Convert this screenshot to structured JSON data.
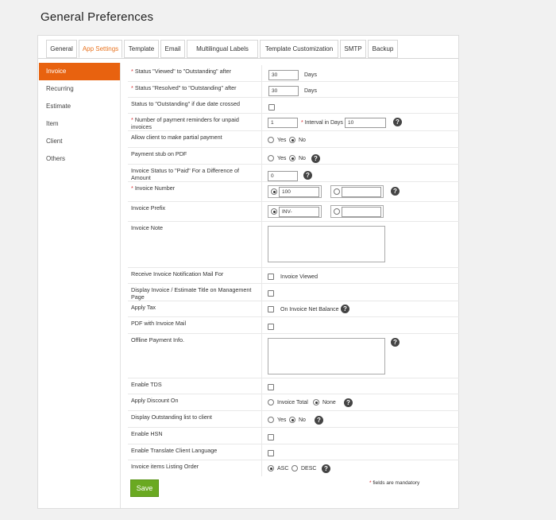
{
  "page_title": "General Preferences",
  "tabs": [
    "General",
    "App Settings",
    "Template",
    "Email",
    "Multilingual Labels",
    "Template Customization",
    "SMTP",
    "Backup"
  ],
  "active_tab": "App Settings",
  "sidebar": [
    "Invoice",
    "Recurring",
    "Estimate",
    "Item",
    "Client",
    "Others"
  ],
  "active_sidebar": "Invoice",
  "form": {
    "viewed_label": "Status \"Viewed\" to \"Outstanding\" after",
    "viewed_days": "30",
    "resolved_label": "Status \"Resolved\" to \"Outstanding\" after",
    "resolved_days": "30",
    "days_unit": "Days",
    "due_label": "Status to \"Outstanding\" if due date crossed",
    "reminders_label": "Number of payment reminders for unpaid invoices",
    "reminders_value": "1",
    "interval_label": "Interval in Days",
    "interval_value": "10",
    "partial_label": "Allow client to make partial payment",
    "yes": "Yes",
    "no": "No",
    "stub_label": "Payment stub on PDF",
    "paid_label": "Invoice Status to \"Paid\" For a Difference of Amount",
    "paid_value": "0",
    "number_label": "Invoice Number",
    "number_value": "100",
    "prefix_label": "Invoice Prefix",
    "prefix_value": "INV-",
    "note_label": "Invoice Note",
    "notif_label": "Receive Invoice Notification Mail For",
    "notif_option": "Invoice Viewed",
    "display_title_label": "Display Invoice / Estimate Title on Management Page",
    "tax_label": "Apply Tax",
    "tax_option": "On Invoice Net Balance",
    "pdf_mail_label": "PDF with Invoice Mail",
    "offline_label": "Offline Payment Info.",
    "tds_label": "Enable TDS",
    "discount_label": "Apply Discount On",
    "discount_total": "Invoice Total",
    "discount_none": "None",
    "outstanding_label": "Display Outstanding list to client",
    "hsn_label": "Enable HSN",
    "translate_label": "Enable Translate Client Language",
    "order_label": "Invoice items Listing Order",
    "asc": "ASC",
    "desc": "DESC"
  },
  "save_label": "Save",
  "mandatory_note": "fields are mandatory",
  "required_mark": "*",
  "help_icon": "?",
  "colors": {
    "accent": "#e8620f",
    "save": "#6aa922",
    "required": "#d9262b"
  }
}
